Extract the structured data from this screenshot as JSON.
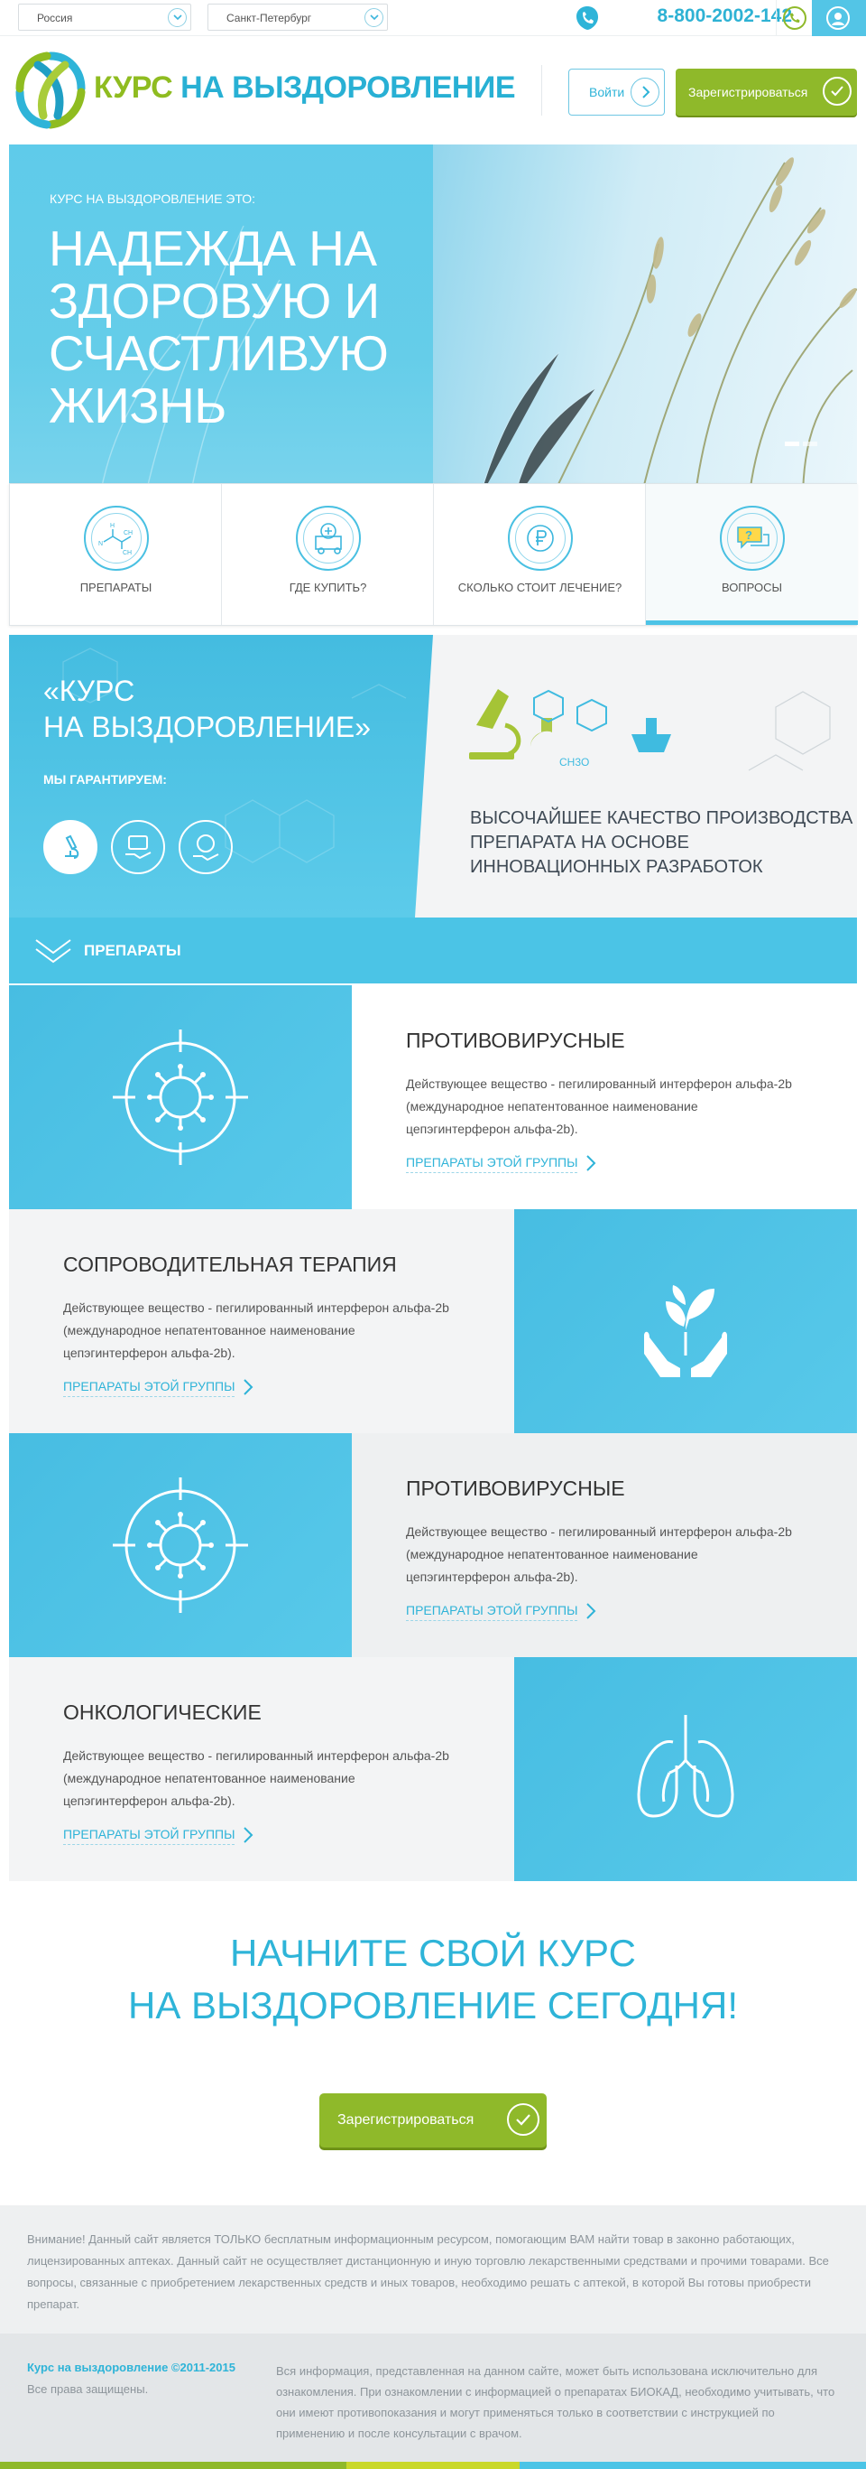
{
  "topbar": {
    "country": "Россия",
    "city": "Санкт-Петербург",
    "phone": "8-800-2002-142"
  },
  "header": {
    "logo_part1": "КУРС",
    "logo_part2": "НА ВЫЗДОРОВЛЕНИЕ",
    "login_label": "Войти",
    "register_label": "Зарегистрироваться"
  },
  "hero": {
    "subtitle": "КУРС НА ВЫЗДОРОВЛЕНИЕ ЭТО:",
    "title": "НАДЕЖДА НА ЗДОРОВУЮ И СЧАСТЛИВУЮ ЖИЗНЬ"
  },
  "tiles": [
    {
      "label": "ПРЕПАРАТЫ",
      "icon": "molecule-icon"
    },
    {
      "label": "ГДЕ КУПИТЬ?",
      "icon": "pharmacy-icon"
    },
    {
      "label": "СКОЛЬКО СТОИТ ЛЕЧЕНИЕ?",
      "icon": "ruble-icon"
    },
    {
      "label": "ВОПРОСЫ",
      "icon": "question-chat-icon"
    }
  ],
  "guarantee": {
    "title_line1": "«КУРС",
    "title_line2": "НА ВЫЗДОРОВЛЕНИЕ»",
    "subtitle": "МЫ ГАРАНТИРУЕМ:",
    "text": "ВЫСОЧАЙШЕЕ КАЧЕСТВО ПРОИЗВОДСТВА ПРЕПАРАТА НА ОСНОВЕ ИННОВАЦИОННЫХ РАЗРАБОТОК",
    "formula_label": "CH3O"
  },
  "section": {
    "title": "ПРЕПАРАТЫ"
  },
  "categories": [
    {
      "title": "ПРОТИВОВИРУСНЫЕ",
      "desc": "Действующее вещество - пегилированный интерферон альфа-2b (международное непатентованное наименование цепэгинтерферон альфа-2b).",
      "link": "ПРЕПАРАТЫ ЭТОЙ ГРУППЫ",
      "icon": "virus-target-icon"
    },
    {
      "title": "СОПРОВОДИТЕЛЬНАЯ ТЕРАПИЯ",
      "desc": "Действующее вещество - пегилированный интерферон альфа-2b (международное непатентованное наименование цепэгинтерферон альфа-2b).",
      "link": "ПРЕПАРАТЫ ЭТОЙ ГРУППЫ",
      "icon": "hands-plant-icon"
    },
    {
      "title": "ПРОТИВОВИРУСНЫЕ",
      "desc": "Действующее вещество - пегилированный интерферон альфа-2b (международное непатентованное наименование цепэгинтерферон альфа-2b).",
      "link": "ПРЕПАРАТЫ ЭТОЙ ГРУППЫ",
      "icon": "virus-target-icon"
    },
    {
      "title": "ОНКОЛОГИЧЕСКИЕ",
      "desc": "Действующее вещество - пегилированный интерферон альфа-2b (международное непатентованное наименование цепэгинтерферон альфа-2b).",
      "link": "ПРЕПАРАТЫ ЭТОЙ ГРУППЫ",
      "icon": "lungs-icon"
    }
  ],
  "cta": {
    "line1": "НАЧНИТЕ СВОЙ КУРС",
    "line2": "НА ВЫЗДОРОВЛЕНИЕ СЕГОДНЯ!",
    "button": "Зарегистрироваться"
  },
  "footer": {
    "disclaimer": "Внимание! Данный сайт является ТОЛЬКО бесплатным информационным ресурсом, помогающим ВАМ найти товар в законно работающих, лицензированных аптеках. Данный сайт не осуществляет дистанционную и иную торговлю лекарственными средствами и прочими товарами. Все вопросы, связанные с приобретением лекарственных средств и иных товаров, необходимо решать с аптекой, в которой Вы готовы приобрести препарат.",
    "copyright": "Курс на выздоровление ©2011-2015",
    "rights": "Все права защищены.",
    "info": "Вся информация, представленная на данном сайте, может быть использована исключительно для ознакомления. При ознакомлении с информацией о препаратах БИОКАД, необходимо учитывать, что они имеют противопоказания и могут применяться только в соответствии с инструкцией по применению и после консультации с врачом."
  },
  "colors": {
    "accent": "#4bc4e6",
    "brand_green": "#8fb92a",
    "text_blue": "#2eb4d8"
  }
}
